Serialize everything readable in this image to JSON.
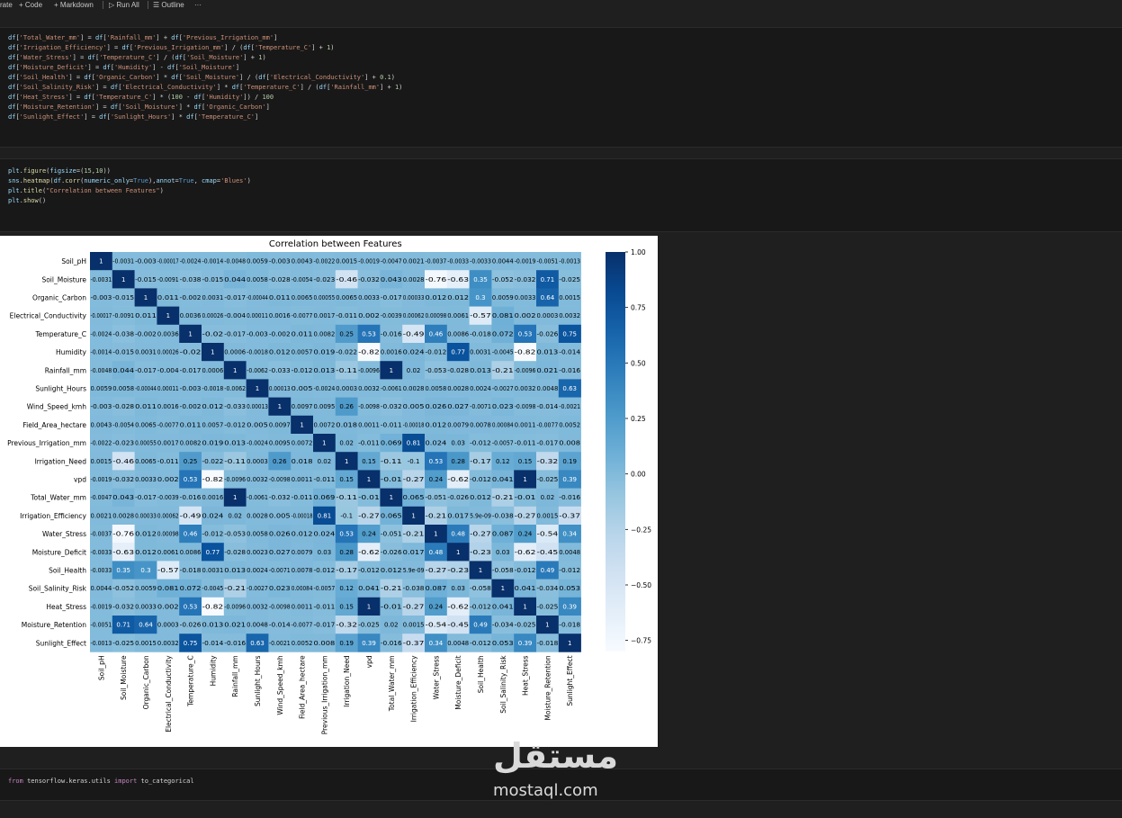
{
  "toolbar": {
    "generate": "rate",
    "code": "Code",
    "markdown": "Markdown",
    "run_all": "Run All",
    "outline": "Outline",
    "more": "···"
  },
  "cells": {
    "features_code": [
      "df['Total_Water_mm'] = df['Rainfall_mm'] + df['Previous_Irrigation_mm']",
      "df['Irrigation_Efficiency'] = df['Previous_Irrigation_mm'] / (df['Temperature_C'] + 1)",
      "df['Water_Stress'] = df['Temperature_C'] / (df['Soil_Moisture'] + 1)",
      "df['Moisture_Deficit'] = df['Humidity'] - df['Soil_Moisture']",
      "df['Soil_Health'] = df['Organic_Carbon'] * df['Soil_Moisture'] / (df['Electrical_Conductivity'] + 0.1)",
      "df['Soil_Salinity_Risk'] = df['Electrical_Conductivity'] * df['Temperature_C'] / (df['Rainfall_mm'] + 1)",
      "df['Heat_Stress'] = df['Temperature_C'] * (100 - df['Humidity']) / 100",
      "df['Moisture_Retention'] = df['Soil_Moisture'] * df['Organic_Carbon']",
      "df['Sunlight_Effect'] = df['Sunlight_Hours'] * df['Temperature_C']"
    ],
    "plot_code": [
      "plt.figure(figsize=(15,10))",
      "sns.heatmap(df.corr(numeric_only=True),annot=True, cmap='Blues')",
      "plt.title(\"Correlation between Features\")",
      "plt.show()"
    ],
    "import_code": "from tensorflow.keras.utils import to_categorical"
  },
  "chart_data": {
    "type": "heatmap",
    "title": "Correlation between Features",
    "cmap": "Blues",
    "colorbar_range": [
      -0.8,
      1.0
    ],
    "colorbar_ticks": [
      "1.00",
      "0.75",
      "0.50",
      "0.25",
      "0.00",
      "−0.25",
      "−0.50",
      "−0.75"
    ],
    "labels": [
      "Soil_pH",
      "Soil_Moisture",
      "Organic_Carbon",
      "Electrical_Conductivity",
      "Temperature_C",
      "Humidity",
      "Rainfall_mm",
      "Sunlight_Hours",
      "Wind_Speed_kmh",
      "Field_Area_hectare",
      "Previous_Irrigation_mm",
      "Irrigation_Need",
      "vpd",
      "Total_Water_mm",
      "Irrigation_Efficiency",
      "Water_Stress",
      "Moisture_Deficit",
      "Soil_Health",
      "Soil_Salinity_Risk",
      "Heat_Stress",
      "Moisture_Retention",
      "Sunlight_Effect"
    ],
    "values": [
      [
        1,
        -0.0031,
        -0.003,
        -0.00017,
        -0.0024,
        -0.0014,
        -0.0048,
        0.0059,
        -0.003,
        0.0043,
        -0.0022,
        0.0015,
        -0.0019,
        -0.0047,
        0.0021,
        -0.0037,
        -0.0033,
        -0.0033,
        0.0044,
        -0.0019,
        -0.0051,
        -0.0013
      ],
      [
        -0.0031,
        1,
        -0.015,
        -0.0091,
        -0.038,
        -0.015,
        0.044,
        0.0058,
        -0.028,
        -0.0054,
        -0.023,
        -0.46,
        -0.032,
        0.043,
        0.0028,
        -0.76,
        -0.63,
        0.35,
        -0.052,
        -0.032,
        0.71,
        -0.025
      ],
      [
        -0.003,
        -0.015,
        1,
        0.011,
        -0.002,
        0.0031,
        -0.017,
        -0.00044,
        0.011,
        0.0065,
        0.00055,
        0.0065,
        0.0033,
        -0.017,
        0.00033,
        0.012,
        0.012,
        0.3,
        0.0059,
        0.0033,
        0.64,
        0.0015
      ],
      [
        -0.00017,
        -0.0091,
        0.011,
        1,
        0.0036,
        0.00026,
        -0.004,
        0.00011,
        0.0016,
        -0.0077,
        0.0017,
        -0.011,
        0.002,
        -0.0039,
        0.00062,
        0.00098,
        0.0061,
        -0.57,
        0.081,
        0.002,
        0.0003,
        0.0032
      ],
      [
        -0.0024,
        -0.038,
        -0.002,
        0.0036,
        1,
        -0.02,
        -0.017,
        -0.003,
        -0.002,
        0.011,
        0.0082,
        0.25,
        0.53,
        -0.016,
        -0.49,
        0.46,
        0.0086,
        -0.018,
        0.072,
        0.53,
        -0.026,
        0.75
      ],
      [
        -0.0014,
        -0.015,
        0.0031,
        0.00026,
        -0.02,
        1,
        0.0006,
        -0.0018,
        0.012,
        0.0057,
        0.019,
        -0.022,
        -0.82,
        0.0016,
        0.024,
        -0.012,
        0.77,
        0.0031,
        -0.0045,
        -0.82,
        0.013,
        -0.014
      ],
      [
        -0.0048,
        0.044,
        -0.017,
        -0.004,
        -0.017,
        0.0006,
        1,
        -0.0062,
        -0.033,
        -0.012,
        0.013,
        -0.11,
        -0.0096,
        1,
        0.02,
        -0.053,
        -0.028,
        0.013,
        -0.21,
        -0.0096,
        0.021,
        -0.016
      ],
      [
        0.0059,
        0.0058,
        -0.00044,
        0.00011,
        -0.003,
        -0.0018,
        -0.0062,
        1,
        0.00013,
        0.005,
        -0.0024,
        0.0003,
        0.0032,
        -0.0061,
        0.0028,
        0.0058,
        0.0028,
        0.0024,
        -0.0027,
        0.0032,
        0.0048,
        0.63
      ],
      [
        -0.003,
        -0.028,
        0.011,
        0.0016,
        -0.002,
        0.012,
        -0.033,
        0.00013,
        1,
        0.0097,
        0.0095,
        0.26,
        -0.0098,
        -0.032,
        0.005,
        0.026,
        0.027,
        -0.0071,
        0.023,
        -0.0098,
        -0.014,
        -0.0021
      ],
      [
        0.0043,
        -0.0054,
        0.0065,
        -0.0077,
        0.011,
        0.0057,
        -0.012,
        0.005,
        0.0097,
        1,
        0.0072,
        0.018,
        0.0011,
        -0.011,
        -0.00018,
        0.012,
        0.0079,
        0.0078,
        0.00084,
        0.0011,
        -0.0077,
        0.0052
      ],
      [
        -0.0022,
        -0.023,
        0.00055,
        0.0017,
        0.0082,
        0.019,
        0.013,
        -0.0024,
        0.0095,
        0.0072,
        1,
        0.02,
        -0.011,
        0.069,
        0.81,
        0.024,
        0.03,
        -0.012,
        -0.0057,
        -0.011,
        -0.017,
        0.008
      ],
      [
        0.0015,
        -0.46,
        0.0065,
        -0.011,
        0.25,
        -0.022,
        -0.11,
        0.0003,
        0.26,
        0.018,
        0.02,
        1,
        0.15,
        -0.11,
        -0.1,
        0.53,
        0.28,
        -0.17,
        0.12,
        0.15,
        -0.32,
        0.19
      ],
      [
        -0.0019,
        -0.032,
        0.0033,
        0.002,
        0.53,
        -0.82,
        -0.0096,
        0.0032,
        -0.0098,
        0.0011,
        -0.011,
        0.15,
        1,
        -0.01,
        -0.27,
        0.24,
        -0.62,
        -0.012,
        0.041,
        1,
        -0.025,
        0.39
      ],
      [
        -0.0047,
        0.043,
        -0.017,
        -0.0039,
        -0.016,
        0.0016,
        1,
        -0.0061,
        -0.032,
        -0.011,
        0.069,
        -0.11,
        -0.01,
        1,
        0.065,
        -0.051,
        -0.026,
        0.012,
        -0.21,
        -0.01,
        0.02,
        -0.016
      ],
      [
        0.0021,
        0.0028,
        0.00033,
        0.00062,
        -0.49,
        0.024,
        0.02,
        0.0028,
        0.005,
        -0.00018,
        0.81,
        -0.1,
        -0.27,
        0.065,
        1,
        -0.21,
        0.017,
        5.9e-09,
        -0.038,
        -0.27,
        0.0015,
        -0.37
      ],
      [
        -0.0037,
        -0.76,
        0.012,
        0.00098,
        0.46,
        -0.012,
        -0.053,
        0.0058,
        0.026,
        0.012,
        0.024,
        0.53,
        0.24,
        -0.051,
        -0.21,
        1,
        0.48,
        -0.27,
        0.087,
        0.24,
        -0.54,
        0.34
      ],
      [
        -0.0033,
        -0.63,
        0.012,
        0.0061,
        0.0086,
        0.77,
        -0.028,
        0.0023,
        0.027,
        0.0079,
        0.03,
        0.28,
        -0.62,
        -0.026,
        0.017,
        0.48,
        1,
        -0.23,
        0.03,
        -0.62,
        -0.45,
        0.0048
      ],
      [
        -0.0033,
        0.35,
        0.3,
        -0.57,
        -0.018,
        0.0031,
        0.013,
        0.0024,
        -0.0071,
        0.0078,
        -0.012,
        -0.17,
        -0.012,
        0.012,
        5.9e-09,
        -0.27,
        -0.23,
        1,
        -0.058,
        -0.012,
        0.49,
        -0.012
      ],
      [
        0.0044,
        -0.052,
        0.0059,
        0.081,
        0.072,
        -0.0045,
        -0.21,
        -0.0027,
        0.023,
        0.00084,
        -0.0057,
        0.12,
        0.041,
        -0.21,
        -0.038,
        0.087,
        0.03,
        -0.058,
        1,
        0.041,
        -0.034,
        0.053
      ],
      [
        -0.0019,
        -0.032,
        0.0033,
        0.002,
        0.53,
        -0.82,
        -0.0096,
        0.0032,
        -0.0098,
        0.0011,
        -0.011,
        0.15,
        1,
        -0.01,
        -0.27,
        0.24,
        -0.62,
        -0.012,
        0.041,
        1,
        -0.025,
        0.39
      ],
      [
        -0.0051,
        0.71,
        0.64,
        0.0003,
        -0.026,
        0.013,
        0.021,
        0.0048,
        -0.014,
        -0.0077,
        -0.017,
        -0.32,
        -0.025,
        0.02,
        0.0015,
        -0.54,
        -0.45,
        0.49,
        -0.034,
        -0.025,
        1,
        -0.018
      ],
      [
        -0.0013,
        -0.025,
        0.0015,
        0.0032,
        0.75,
        -0.014,
        -0.016,
        0.63,
        -0.0021,
        0.0052,
        0.008,
        0.19,
        0.39,
        -0.016,
        -0.37,
        0.34,
        0.0048,
        -0.012,
        0.053,
        0.39,
        -0.018,
        1
      ]
    ],
    "annotations": [
      [
        "1",
        "-0.0031",
        "-0.003",
        "-0.00017",
        "-0.0024",
        "-0.0014",
        "-0.0048",
        "0.0059",
        "-0.003",
        "0.0043",
        "-0.0022",
        "0.0015",
        "-0.0019",
        "-0.0047",
        "0.0021",
        "-0.0037",
        "-0.0033",
        "-0.0033",
        "0.0044",
        "-0.0019",
        "-0.0051",
        "-0.0013"
      ],
      [
        "-0.0031",
        "1",
        "-0.015",
        "-0.0091",
        "-0.038",
        "-0.015",
        "0.044",
        "0.0058",
        "-0.028",
        "-0.0054",
        "-0.023",
        "-0.46",
        "-0.032",
        "0.043",
        "0.0028",
        "-0.76",
        "-0.63",
        "0.35",
        "-0.052",
        "-0.032",
        "0.71",
        "-0.025"
      ],
      [
        "-0.003",
        "-0.015",
        "1",
        "0.011",
        "-0.002",
        "0.0031",
        "-0.017",
        "-0.00044",
        "0.011",
        "0.0065",
        "0.00055",
        "0.0065",
        "0.0033",
        "-0.017",
        "0.00033",
        "0.012",
        "0.012",
        "0.3",
        "0.0059",
        "0.0033",
        "0.64",
        "0.0015"
      ],
      [
        "-0.00017",
        "-0.0091",
        "0.011",
        "1",
        "0.0036",
        "0.00026",
        "-0.004",
        "0.00011",
        "0.0016",
        "-0.0077",
        "0.0017",
        "-0.011",
        "0.002",
        "-0.0039",
        "0.00062",
        "0.00098",
        "0.0061",
        "-0.57",
        "0.081",
        "0.002",
        "0.0003",
        "0.0032"
      ],
      [
        "-0.0024",
        "-0.038",
        "-0.002",
        "0.0036",
        "1",
        "-0.02",
        "-0.017",
        "-0.003",
        "-0.002",
        "0.011",
        "0.0082",
        "0.25",
        "0.53",
        "-0.016",
        "-0.49",
        "0.46",
        "0.0086",
        "-0.018",
        "0.072",
        "0.53",
        "-0.026",
        "0.75"
      ],
      [
        "-0.0014",
        "-0.015",
        "0.0031",
        "0.00026",
        "-0.02",
        "1",
        "0.0006",
        "-0.0018",
        "0.012",
        "0.0057",
        "0.019",
        "-0.022",
        "-0.82",
        "0.0016",
        "0.024",
        "-0.012",
        "0.77",
        "0.0031",
        "-0.0045",
        "-0.82",
        "0.013",
        "-0.014"
      ],
      [
        "-0.0048",
        "0.044",
        "-0.017",
        "-0.004",
        "-0.017",
        "0.0006",
        "1",
        "-0.0062",
        "-0.033",
        "-0.012",
        "0.013",
        "-0.11",
        "-0.0096",
        "1",
        "0.02",
        "-0.053",
        "-0.028",
        "0.013",
        "-0.21",
        "-0.0096",
        "0.021",
        "-0.016"
      ],
      [
        "0.0059",
        "0.0058",
        "-0.00044",
        "0.00011",
        "-0.003",
        "-0.0018",
        "-0.0062",
        "1",
        "0.00013",
        "0.005",
        "-0.0024",
        "0.0003",
        "0.0032",
        "-0.0061",
        "0.0028",
        "0.0058",
        "0.0028",
        "0.0024",
        "-0.0027",
        "0.0032",
        "0.0048",
        "0.63"
      ],
      [
        "-0.003",
        "-0.028",
        "0.011",
        "0.0016",
        "-0.002",
        "0.012",
        "-0.033",
        "0.00013",
        "1",
        "0.0097",
        "0.0095",
        "0.26",
        "-0.0098",
        "-0.032",
        "0.005",
        "0.026",
        "0.027",
        "-0.0071",
        "0.023",
        "-0.0098",
        "-0.014",
        "-0.0021"
      ],
      [
        "0.0043",
        "-0.0054",
        "0.0065",
        "-0.0077",
        "0.011",
        "0.0057",
        "-0.012",
        "0.005",
        "0.0097",
        "1",
        "0.0072",
        "0.018",
        "0.0011",
        "-0.011",
        "-0.00018",
        "0.012",
        "0.0079",
        "0.0078",
        "0.00084",
        "0.0011",
        "-0.0077",
        "0.0052"
      ],
      [
        "-0.0022",
        "-0.023",
        "0.00055",
        "0.0017",
        "0.0082",
        "0.019",
        "0.013",
        "-0.0024",
        "0.0095",
        "0.0072",
        "1",
        "0.02",
        "-0.011",
        "0.069",
        "0.81",
        "0.024",
        "0.03",
        "-0.012",
        "-0.0057",
        "-0.011",
        "-0.017",
        "0.008"
      ],
      [
        "0.0015",
        "-0.46",
        "0.0065",
        "-0.011",
        "0.25",
        "-0.022",
        "-0.11",
        "0.0003",
        "0.26",
        "0.018",
        "0.02",
        "1",
        "0.15",
        "-0.11",
        "-0.1",
        "0.53",
        "0.28",
        "-0.17",
        "0.12",
        "0.15",
        "-0.32",
        "0.19"
      ],
      [
        "-0.0019",
        "-0.032",
        "0.0033",
        "0.002",
        "0.53",
        "-0.82",
        "-0.0096",
        "0.0032",
        "-0.0098",
        "0.0011",
        "-0.011",
        "0.15",
        "1",
        "-0.01",
        "-0.27",
        "0.24",
        "-0.62",
        "-0.012",
        "0.041",
        "1",
        "-0.025",
        "0.39"
      ],
      [
        "-0.0047",
        "0.043",
        "-0.017",
        "-0.0039",
        "-0.016",
        "0.0016",
        "1",
        "-0.0061",
        "-0.032",
        "-0.011",
        "0.069",
        "-0.11",
        "-0.01",
        "1",
        "0.065",
        "-0.051",
        "-0.026",
        "0.012",
        "-0.21",
        "-0.01",
        "0.02",
        "-0.016"
      ],
      [
        "0.0021",
        "0.0028",
        "0.00033",
        "0.00062",
        "-0.49",
        "0.024",
        "0.02",
        "0.0028",
        "0.005",
        "-0.00018",
        "0.81",
        "-0.1",
        "-0.27",
        "0.065",
        "1",
        "-0.21",
        "0.017",
        "5.9e-09",
        "-0.038",
        "-0.27",
        "0.0015",
        "-0.37"
      ],
      [
        "-0.0037",
        "-0.76",
        "0.012",
        "0.00098",
        "0.46",
        "-0.012",
        "-0.053",
        "0.0058",
        "0.026",
        "0.012",
        "0.024",
        "0.53",
        "0.24",
        "-0.051",
        "-0.21",
        "1",
        "0.48",
        "-0.27",
        "0.087",
        "0.24",
        "-0.54",
        "0.34"
      ],
      [
        "-0.0033",
        "-0.63",
        "0.012",
        "0.0061",
        "0.0086",
        "0.77",
        "-0.028",
        "0.0023",
        "0.027",
        "0.0079",
        "0.03",
        "0.28",
        "-0.62",
        "-0.026",
        "0.017",
        "0.48",
        "1",
        "-0.23",
        "0.03",
        "-0.62",
        "-0.45",
        "0.0048"
      ],
      [
        "-0.0033",
        "0.35",
        "0.3",
        "-0.57",
        "-0.018",
        "0.0031",
        "0.013",
        "0.0024",
        "-0.0071",
        "0.0078",
        "-0.012",
        "-0.17",
        "-0.012",
        "0.012",
        "5.9e-09",
        "-0.27",
        "-0.23",
        "1",
        "-0.058",
        "-0.012",
        "0.49",
        "-0.012"
      ],
      [
        "0.0044",
        "-0.052",
        "0.0059",
        "0.081",
        "0.072",
        "-0.0045",
        "-0.21",
        "-0.0027",
        "0.023",
        "0.00084",
        "-0.0057",
        "0.12",
        "0.041",
        "-0.21",
        "-0.038",
        "0.087",
        "0.03",
        "-0.058",
        "1",
        "0.041",
        "-0.034",
        "0.053"
      ],
      [
        "-0.0019",
        "-0.032",
        "0.0033",
        "0.002",
        "0.53",
        "-0.82",
        "-0.0096",
        "0.0032",
        "-0.0098",
        "0.0011",
        "-0.011",
        "0.15",
        "1",
        "-0.01",
        "-0.27",
        "0.24",
        "-0.62",
        "-0.012",
        "0.041",
        "1",
        "-0.025",
        "0.39"
      ],
      [
        "-0.0051",
        "0.71",
        "0.64",
        "0.0003",
        "-0.026",
        "0.013",
        "0.021",
        "0.0048",
        "-0.014",
        "-0.0077",
        "-0.017",
        "-0.32",
        "-0.025",
        "0.02",
        "0.0015",
        "-0.54",
        "-0.45",
        "0.49",
        "-0.034",
        "-0.025",
        "1",
        "-0.018"
      ],
      [
        "-0.0013",
        "-0.025",
        "0.0015",
        "0.0032",
        "0.75",
        "-0.014",
        "-0.016",
        "0.63",
        "-0.0021",
        "0.0052",
        "0.008",
        "0.19",
        "0.39",
        "-0.016",
        "-0.37",
        "0.34",
        "0.0048",
        "-0.012",
        "0.053",
        "0.39",
        "-0.018",
        "1"
      ]
    ]
  },
  "watermark": {
    "arabic": "مستقل",
    "latin": "mostaql.com"
  },
  "colors": {
    "background": "#1f1f1f",
    "cell_background": "#181818",
    "keyword": "#c586c0",
    "string": "#ce9178",
    "variable": "#9cdcfe",
    "function": "#dcdcaa",
    "number": "#b5cea8"
  }
}
